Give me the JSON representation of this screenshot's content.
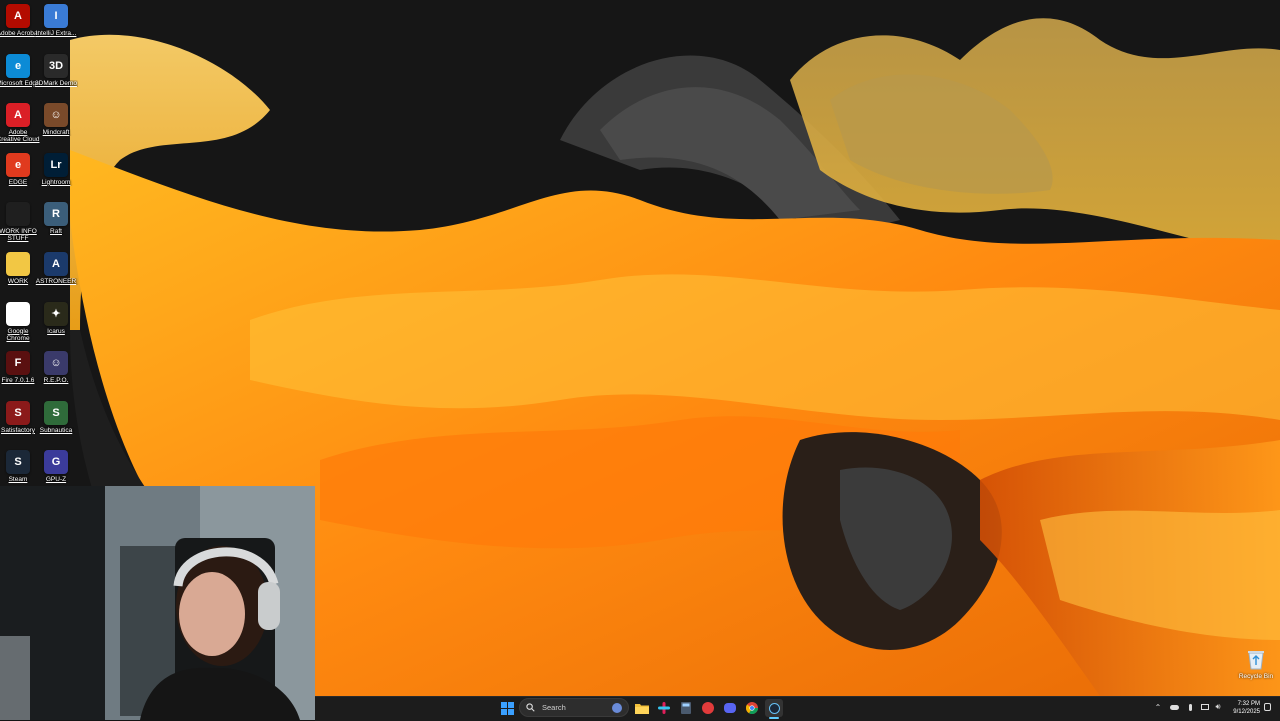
{
  "desktop_icons": [
    {
      "label": "Adobe Acrobat",
      "icon": "acrobat-icon",
      "color": "#b30b00",
      "glyph": "A"
    },
    {
      "label": "IntelliJ Extra...",
      "icon": "document-icon",
      "color": "#3a7bd5",
      "glyph": "I"
    },
    {
      "label": "Microsoft Edge",
      "icon": "edge-icon",
      "color": "#0c8bd6",
      "glyph": "e"
    },
    {
      "label": "3DMark Demo",
      "icon": "3dmark-icon",
      "color": "#2a2a2a",
      "glyph": "3D"
    },
    {
      "label": "Adobe Creative Cloud",
      "icon": "adobe-icon",
      "color": "#da1f26",
      "glyph": "A"
    },
    {
      "label": "Mindcraft",
      "icon": "game-face-icon",
      "color": "#7a4a2a",
      "glyph": "☺"
    },
    {
      "label": "EDGE",
      "icon": "edge-app-icon",
      "color": "#e03a1e",
      "glyph": "e"
    },
    {
      "label": "Lightroom",
      "icon": "lightroom-icon",
      "color": "#001e36",
      "glyph": "Lr"
    },
    {
      "label": "WORK INFO STUFF",
      "icon": "folder-icon",
      "color": "#1f1f1f",
      "glyph": ""
    },
    {
      "label": "Raft",
      "icon": "raft-icon",
      "color": "#3b5e7a",
      "glyph": "R"
    },
    {
      "label": "WORK",
      "icon": "folder-icon",
      "color": "#f2c744",
      "glyph": ""
    },
    {
      "label": "ASTRONEER",
      "icon": "astroneer-icon",
      "color": "#1b3a6b",
      "glyph": "A"
    },
    {
      "label": "Google Chrome",
      "icon": "chrome-icon",
      "color": "#ffffff",
      "glyph": ""
    },
    {
      "label": "Icarus",
      "icon": "icarus-icon",
      "color": "#2a2a1a",
      "glyph": "✦"
    },
    {
      "label": "Fire 7.0.1.6",
      "icon": "fire-icon",
      "color": "#5a1010",
      "glyph": "F"
    },
    {
      "label": "R.E.P.O.",
      "icon": "repo-icon",
      "color": "#3a3a6a",
      "glyph": "☺"
    },
    {
      "label": "Satisfactory",
      "icon": "satisfactory-icon",
      "color": "#8b1a1a",
      "glyph": "S"
    },
    {
      "label": "Subnautica",
      "icon": "subnautica-icon",
      "color": "#2f6b3a",
      "glyph": "S"
    },
    {
      "label": "Steam",
      "icon": "steam-icon",
      "color": "#1b2838",
      "glyph": "S"
    },
    {
      "label": "GPU-Z",
      "icon": "gpuz-icon",
      "color": "#3b3b9a",
      "glyph": "G"
    }
  ],
  "recycle_bin": {
    "label": "Recycle Bin"
  },
  "taskbar": {
    "search_placeholder": "Search",
    "apps": [
      "start-icon",
      "search-icon",
      "copilot-icon",
      "file-explorer-icon",
      "slack-icon",
      "calculator-icon",
      "chrome-icon",
      "discord-icon",
      "steam-icon"
    ]
  },
  "system_tray": {
    "time": "7:32 PM",
    "date": "9/12/2025"
  },
  "colors": {
    "accent": "#ffa31a",
    "taskbar": "#1c1c1c",
    "wallpaper_bg": "#141414"
  }
}
